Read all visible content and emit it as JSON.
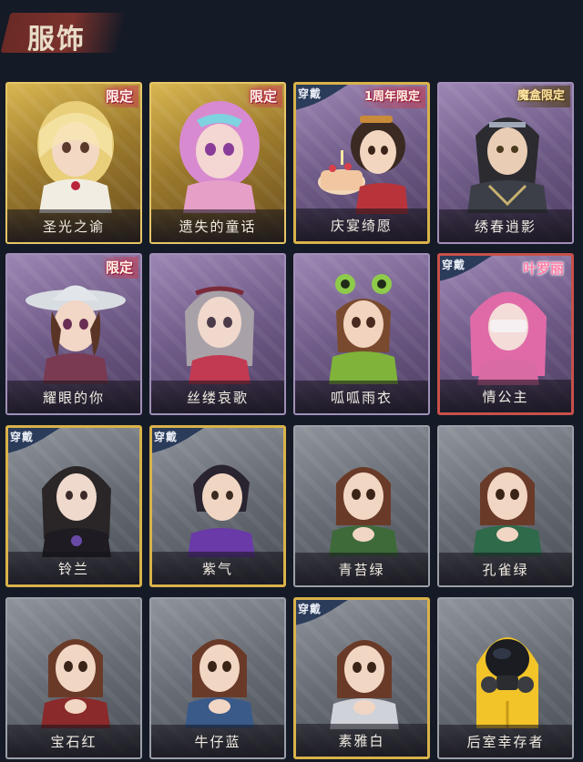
{
  "header": {
    "title": "服饰"
  },
  "badges": {
    "wear": "穿戴"
  },
  "colors": {
    "background": "#141a26",
    "title_banner": "#7b322c",
    "gold_frame": "#d9b24a",
    "purple_frame": "#a18fb8",
    "gray_frame": "#9ba0a8"
  },
  "items": [
    {
      "name": "圣光之谕",
      "tier": "gold",
      "limit": "限定",
      "equipped": false,
      "icon": "blonde-veiled-lady-portrait"
    },
    {
      "name": "遗失的童话",
      "tier": "gold",
      "limit": "限定",
      "equipped": false,
      "icon": "pink-haired-girl-portrait"
    },
    {
      "name": "庆宴绮愿",
      "tier": "purple",
      "limit": "1周年限定",
      "equipped": true,
      "icon": "boy-with-cake-portrait"
    },
    {
      "name": "绣春逍影",
      "tier": "purple",
      "limit": "魔盒限定",
      "equipped": false,
      "icon": "swordsman-portrait"
    },
    {
      "name": "耀眼的你",
      "tier": "purple",
      "limit": "限定",
      "equipped": false,
      "icon": "cowboy-hat-girl-portrait"
    },
    {
      "name": "丝缕哀歌",
      "tier": "purple",
      "limit": "",
      "equipped": false,
      "icon": "gray-haired-girl-portrait"
    },
    {
      "name": "呱呱雨衣",
      "tier": "purple",
      "limit": "",
      "equipped": false,
      "icon": "frog-raincoat-girl-portrait"
    },
    {
      "name": "情公主",
      "tier": "purple",
      "limit": "叶罗丽",
      "equipped": true,
      "icon": "pink-princess-portrait"
    },
    {
      "name": "铃兰",
      "tier": "gray",
      "limit": "",
      "equipped": true,
      "icon": "dark-haired-lady-portrait"
    },
    {
      "name": "紫气",
      "tier": "gray",
      "limit": "",
      "equipped": true,
      "icon": "dark-haired-boy-portrait"
    },
    {
      "name": "青苔绿",
      "tier": "gray",
      "limit": "",
      "equipped": false,
      "icon": "girl-green-cloak-portrait"
    },
    {
      "name": "孔雀绿",
      "tier": "gray",
      "limit": "",
      "equipped": false,
      "icon": "girl-teal-cloak-portrait"
    },
    {
      "name": "宝石红",
      "tier": "gray",
      "limit": "",
      "equipped": false,
      "icon": "girl-red-cloak-portrait"
    },
    {
      "name": "牛仔蓝",
      "tier": "gray",
      "limit": "",
      "equipped": false,
      "icon": "girl-blue-cloak-portrait"
    },
    {
      "name": "素雅白",
      "tier": "gray",
      "limit": "",
      "equipped": true,
      "icon": "girl-white-cloak-portrait"
    },
    {
      "name": "后室幸存者",
      "tier": "gray",
      "limit": "",
      "equipped": false,
      "icon": "hazmat-suit-portrait"
    }
  ]
}
